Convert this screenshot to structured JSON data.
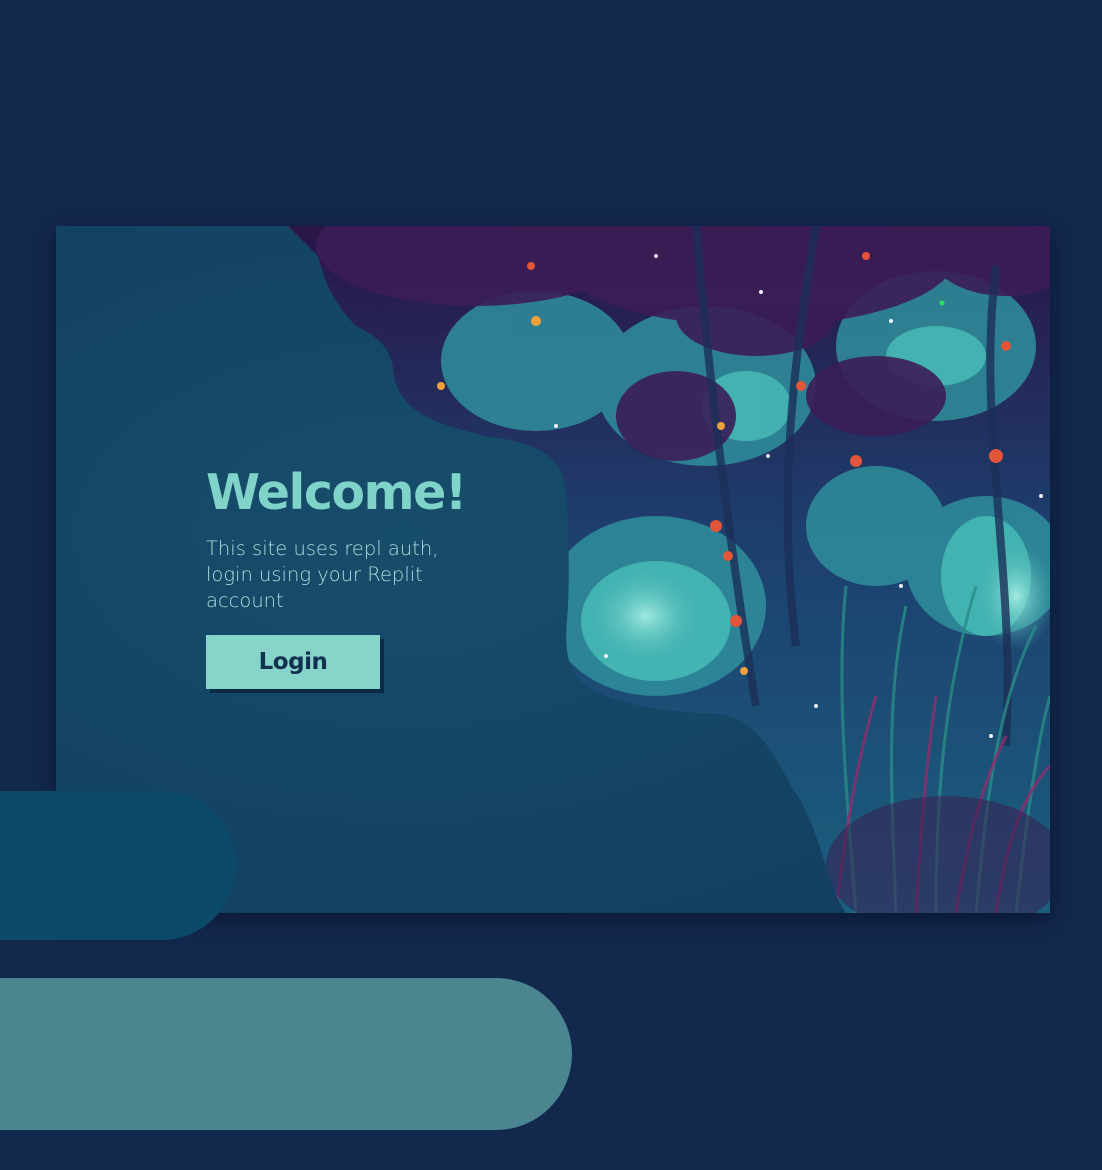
{
  "login_card": {
    "title": "Welcome!",
    "description": "This site uses repl auth, login using your Replit account",
    "login_button_label": "Login"
  },
  "colors": {
    "page_background": "#13284d",
    "card_background": "#144666",
    "accent": "#86d4ca",
    "title_color": "#7fd3c9",
    "deco_pill_dark": "#0b4a68",
    "deco_pill_light": "#4b858f"
  },
  "illustration": {
    "icon": "forest-foliage-illustration"
  }
}
